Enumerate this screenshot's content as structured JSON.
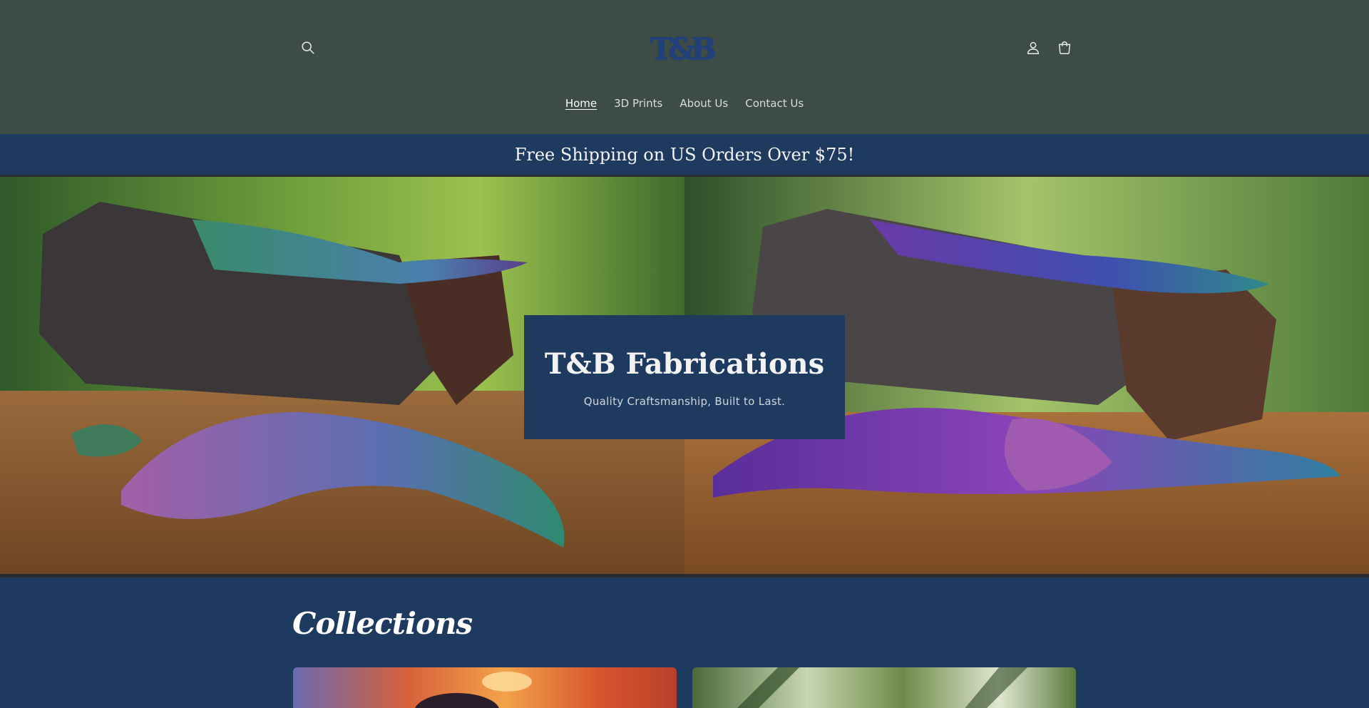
{
  "header": {
    "logo_text": "T&B",
    "icons": {
      "search": "search-icon",
      "account": "account-icon",
      "cart": "cart-icon"
    }
  },
  "nav": {
    "items": [
      {
        "label": "Home",
        "active": true
      },
      {
        "label": "3D Prints",
        "active": false
      },
      {
        "label": "About Us",
        "active": false
      },
      {
        "label": "Contact Us",
        "active": false
      }
    ]
  },
  "announcement": {
    "text": "Free Shipping on US Orders Over $75!"
  },
  "hero": {
    "title": "T&B Fabrications",
    "subtitle": "Quality Craftsmanship, Built to Last."
  },
  "collections": {
    "heading": "Collections"
  },
  "colors": {
    "header_bg": "#3d4c45",
    "brand_navy": "#1f3a5f",
    "logo": "#23407a"
  }
}
